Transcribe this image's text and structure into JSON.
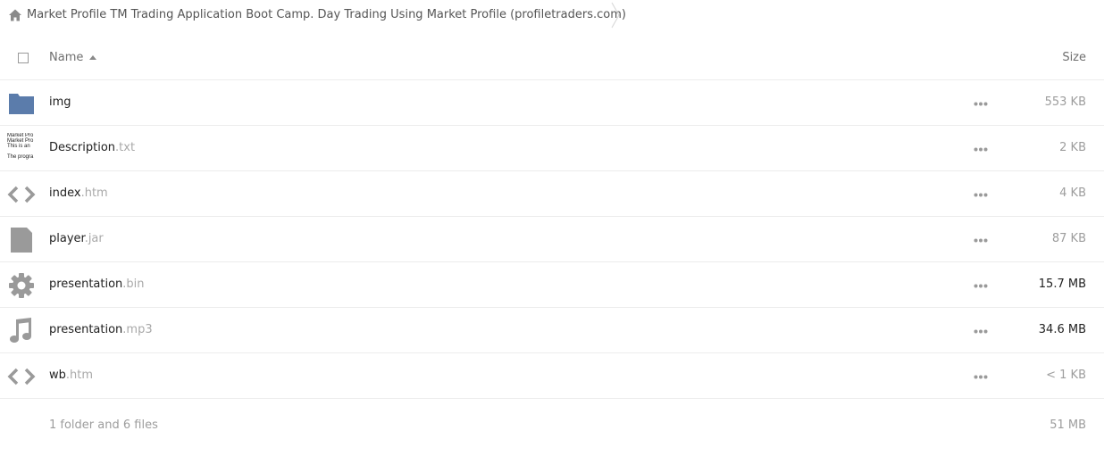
{
  "breadcrumb": {
    "home_icon": "home-icon",
    "folder_title": "Market Profile TM Trading Application Boot Camp. Day Trading Using Market Profile (profiletraders.com)"
  },
  "header": {
    "name_label": "Name",
    "size_label": "Size",
    "sort_direction": "ascending"
  },
  "files": [
    {
      "base": "img",
      "ext": "",
      "size": "553 KB",
      "icon": "folder-icon"
    },
    {
      "base": "Description",
      "ext": ".txt",
      "size": "2 KB",
      "icon": "text-thumbnail",
      "thumb_lines": [
        "Market Pro",
        "Market Pro",
        "This is an",
        "",
        "The progra"
      ]
    },
    {
      "base": "index",
      "ext": ".htm",
      "size": "4 KB",
      "icon": "code-icon"
    },
    {
      "base": "player",
      "ext": ".jar",
      "size": "87 KB",
      "icon": "file-icon"
    },
    {
      "base": "presentation",
      "ext": ".bin",
      "size": "15.7 MB",
      "icon": "gear-icon"
    },
    {
      "base": "presentation",
      "ext": ".mp3",
      "size": "34.6 MB",
      "icon": "music-note-icon"
    },
    {
      "base": "wb",
      "ext": ".htm",
      "size": "< 1 KB",
      "icon": "code-icon"
    }
  ],
  "footer": {
    "summary": "1 folder and 6 files",
    "total_size": "51 MB"
  },
  "colors": {
    "folder": "#5b7cab",
    "icon_gray": "#9a9a9a",
    "border": "#ececec"
  }
}
